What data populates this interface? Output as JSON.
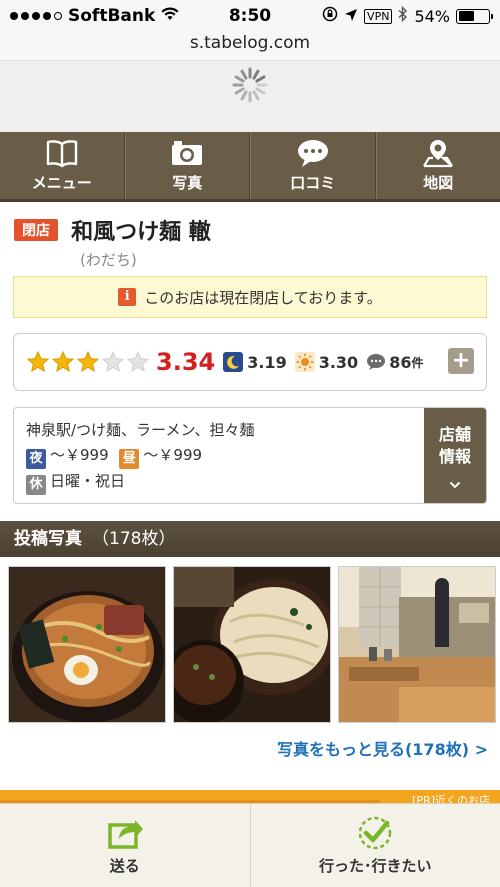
{
  "status_bar": {
    "carrier": "SoftBank",
    "time": "8:50",
    "vpn": "VPN",
    "battery": "54%",
    "battery_level": 0.54
  },
  "url_bar": {
    "url": "s.tabelog.com"
  },
  "nav": {
    "items": [
      {
        "label": "メニュー",
        "icon": "book-icon"
      },
      {
        "label": "写真",
        "icon": "camera-icon"
      },
      {
        "label": "口コミ",
        "icon": "speech-bubble-icon"
      },
      {
        "label": "地図",
        "icon": "map-pin-icon"
      }
    ]
  },
  "shop": {
    "status_badge": "閉店",
    "name": "和風つけ麺 轍",
    "kana": "(わだち)",
    "closed_notice": "このお店は現在閉店しております。",
    "notice_icon": "i"
  },
  "rating": {
    "stars": 3,
    "star_max": 5,
    "score": "3.34",
    "night_score": "3.19",
    "day_score": "3.30",
    "review_count": "86",
    "review_unit": "件",
    "plus": "+"
  },
  "info": {
    "genre": "神泉駅/つけ麺、ラーメン、担々麺",
    "night_tag": "夜",
    "night_budget": "～￥999",
    "day_tag": "昼",
    "day_budget": "～￥999",
    "holiday_tag": "休",
    "holidays": "日曜・祝日",
    "store_info_button": "店舗\n情報"
  },
  "photos": {
    "header": "投稿写真",
    "count": "（178枚）",
    "more_link": "写真をもっと見る(178枚) >"
  },
  "ad_strip": {
    "text": "[PR]近くのお店"
  },
  "bottom_bar": {
    "send_label": "送る",
    "went_label": "行った･行きたい"
  },
  "colors": {
    "nav_bg": "#6a5d48",
    "closed_badge": "#e3532b",
    "score_red": "#d41f1f",
    "link_blue": "#1f71b8",
    "ad_orange": "#f2a51f"
  }
}
